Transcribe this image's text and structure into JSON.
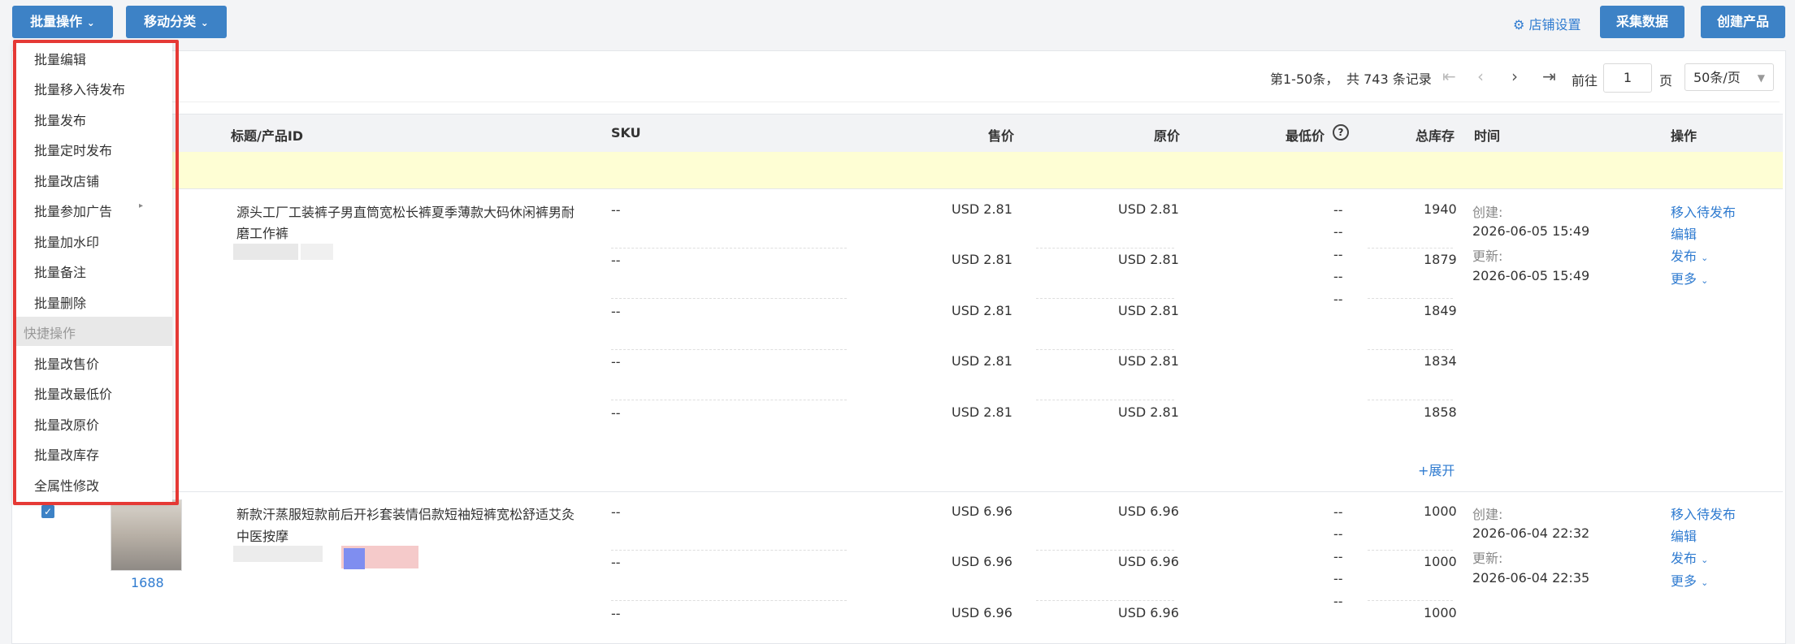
{
  "toolbar": {
    "batch_ops": "批量操作",
    "move_category": "移动分类",
    "store_settings": "店铺设置",
    "collect_data": "采集数据",
    "create_product": "创建产品"
  },
  "pagination": {
    "range": "第1-50条，",
    "total": "共 743 条记录",
    "goto_label": "前往",
    "page_value": "1",
    "page_unit": "页",
    "page_size": "50条/页"
  },
  "columns": {
    "title": "标题/产品ID",
    "sku": "SKU",
    "price": "售价",
    "original": "原价",
    "min_price": "最低价",
    "stock": "总库存",
    "time": "时间",
    "actions": "操作"
  },
  "products": [
    {
      "title_line1": "源头工厂工装裤子男直筒宽松长裤夏季薄款大码休闲裤男耐",
      "title_line2": "磨工作裤",
      "skus": [
        {
          "sku": "--",
          "price": "USD 2.81",
          "original": "USD 2.81",
          "stock": "1940"
        },
        {
          "sku": "--",
          "price": "USD 2.81",
          "original": "USD 2.81",
          "stock": "1879"
        },
        {
          "sku": "--",
          "price": "USD 2.81",
          "original": "USD 2.81",
          "stock": "1849"
        },
        {
          "sku": "--",
          "price": "USD 2.81",
          "original": "USD 2.81",
          "stock": "1834"
        },
        {
          "sku": "--",
          "price": "USD 2.81",
          "original": "USD 2.81",
          "stock": "1858"
        }
      ],
      "min_prices": [
        "--",
        "--",
        "--",
        "--",
        "--"
      ],
      "created_label": "创建:",
      "created": "2026-06-05 15:49",
      "updated_label": "更新:",
      "updated": "2026-06-05 15:49",
      "expand": "+展开",
      "actions": {
        "move": "移入待发布",
        "edit": "编辑",
        "publish": "发布",
        "more": "更多"
      }
    },
    {
      "title_line1": "新款汗蒸服短款前后开衫套装情侣款短袖短裤宽松舒适艾灸",
      "title_line2": "中医按摩",
      "source": "1688",
      "skus": [
        {
          "sku": "--",
          "price": "USD 6.96",
          "original": "USD 6.96",
          "stock": "1000"
        },
        {
          "sku": "--",
          "price": "USD 6.96",
          "original": "USD 6.96",
          "stock": "1000"
        },
        {
          "sku": "--",
          "price": "USD 6.96",
          "original": "USD 6.96",
          "stock": "1000"
        }
      ],
      "min_prices": [
        "--",
        "--",
        "--",
        "--",
        "--"
      ],
      "created_label": "创建:",
      "created": "2026-06-04 22:32",
      "updated_label": "更新:",
      "updated": "2026-06-04 22:35",
      "actions": {
        "move": "移入待发布",
        "edit": "编辑",
        "publish": "发布",
        "more": "更多"
      }
    }
  ],
  "menu": {
    "items": [
      "批量编辑",
      "批量移入待发布",
      "批量发布",
      "批量定时发布",
      "批量改店铺",
      "批量参加广告",
      "批量加水印",
      "批量备注",
      "批量删除"
    ],
    "section": "快捷操作",
    "quick_items": [
      "批量改售价",
      "批量改最低价",
      "批量改原价",
      "批量改库存",
      "全属性修改"
    ]
  }
}
